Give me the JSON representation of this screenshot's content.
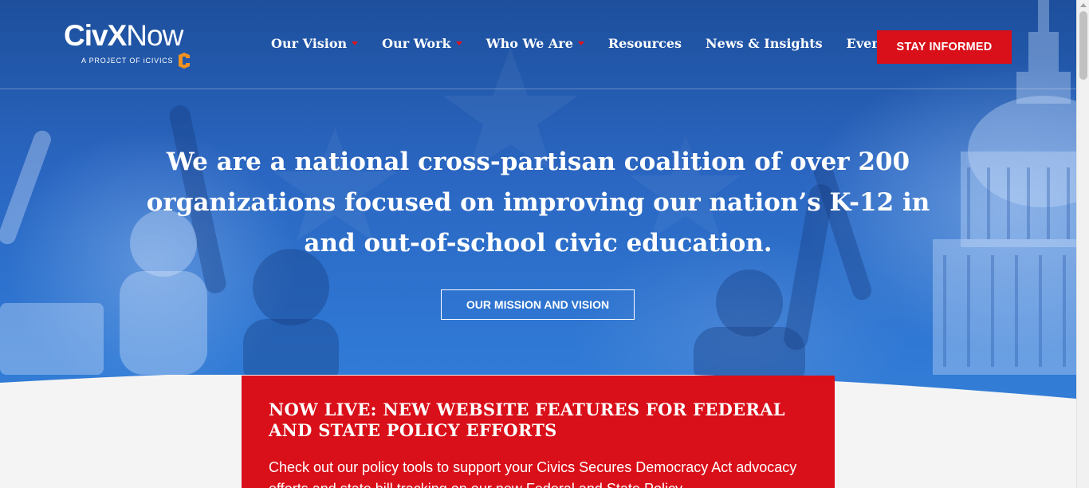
{
  "header": {
    "logo": {
      "name": "CivXNow",
      "tagline": "A PROJECT OF iCIVICS"
    },
    "nav": [
      {
        "label": "Our Vision",
        "has_dropdown": true
      },
      {
        "label": "Our Work",
        "has_dropdown": true
      },
      {
        "label": "Who We Are",
        "has_dropdown": true
      },
      {
        "label": "Resources",
        "has_dropdown": false
      },
      {
        "label": "News & Insights",
        "has_dropdown": false
      },
      {
        "label": "Events",
        "has_dropdown": false
      }
    ],
    "cta_label": "STAY INFORMED"
  },
  "hero": {
    "headline": "We are a national cross-partisan coalition of over 200 organizations focused on improving our nation’s K-12 in and out-of-school civic education.",
    "button_label": "OUR MISSION AND VISION"
  },
  "announcement": {
    "title": "NOW LIVE: NEW WEBSITE FEATURES FOR FEDERAL AND STATE POLICY EFFORTS",
    "body": "Check out our policy tools to support your Civics Secures Democracy Act advocacy efforts and state bill tracking on our new Federal and State Policy"
  },
  "colors": {
    "primary_red": "#d90f19",
    "hero_blue": "#2a66c1",
    "brand_orange": "#f39221"
  }
}
